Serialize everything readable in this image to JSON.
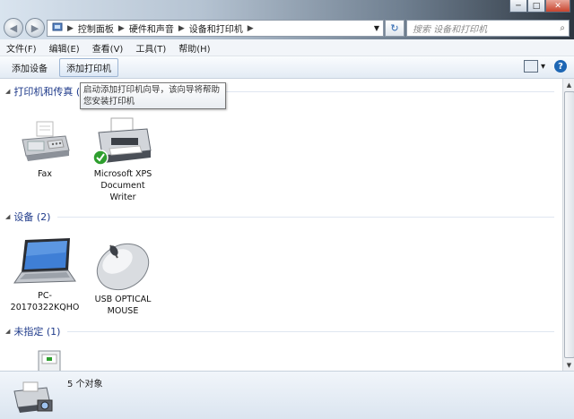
{
  "window": {
    "minimize": "─",
    "maximize": "□",
    "close": "✕"
  },
  "nav": {
    "back": "◀",
    "forward": "▶"
  },
  "address": {
    "icon": "control-panel-icon",
    "segments": [
      "控制面板",
      "硬件和声音",
      "设备和打印机"
    ],
    "sep": "▶",
    "dropdown": "▼"
  },
  "refresh": "↻",
  "search": {
    "placeholder": "搜索 设备和打印机",
    "icon": "⌕"
  },
  "menu": [
    "文件(F)",
    "编辑(E)",
    "查看(V)",
    "工具(T)",
    "帮助(H)"
  ],
  "toolbar": {
    "add_device": "添加设备",
    "add_printer": "添加打印机",
    "view": "▾",
    "help": "?"
  },
  "tooltip": "启动添加打印机向导，该向导将帮助您安装打印机",
  "groups": {
    "printers": {
      "label": "打印机和传真 (2)",
      "tri": "◢",
      "items": [
        {
          "name": "Fax",
          "icon": "fax-icon"
        },
        {
          "name": "Microsoft XPS Document Writer",
          "icon": "printer-icon",
          "default": true
        }
      ]
    },
    "devices": {
      "label": "设备 (2)",
      "tri": "◢",
      "items": [
        {
          "name": "PC-20170322KQHO",
          "icon": "laptop-icon"
        },
        {
          "name": "USB OPTICAL MOUSE",
          "icon": "mouse-icon"
        }
      ]
    },
    "unspecified": {
      "label": "未指定 (1)",
      "tri": "◢",
      "items": [
        {
          "name": "",
          "icon": "device-box-icon"
        }
      ]
    }
  },
  "status": {
    "count_text": "5 个对象",
    "icon": "printer-camera-icon"
  },
  "colors": {
    "group_label": "#1e3a8a",
    "accent": "#1d66b4",
    "check": "#2e9e2e"
  }
}
